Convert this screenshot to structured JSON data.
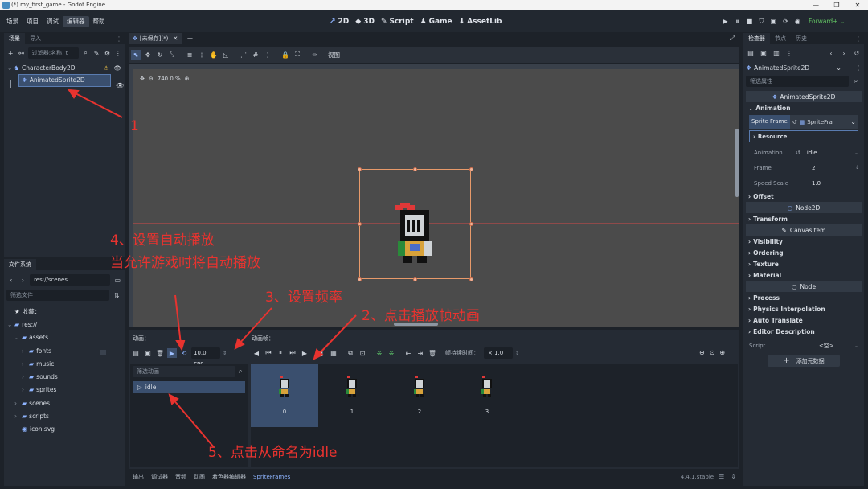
{
  "window": {
    "title": "(*) my_first_game - Godot Engine"
  },
  "menu": [
    "场景",
    "项目",
    "调试",
    "编辑器",
    "帮助"
  ],
  "workspaces": [
    {
      "icon": "↗",
      "label": "2D"
    },
    {
      "icon": "◆",
      "label": "3D"
    },
    {
      "icon": "✎",
      "label": "Script"
    },
    {
      "icon": "♟",
      "label": "Game"
    },
    {
      "icon": "⬇",
      "label": "AssetLib"
    }
  ],
  "renderer": "Forward+",
  "scene_dock": {
    "tabs": [
      "场景",
      "导入"
    ],
    "filter_placeholder": "过滤器:名称, t",
    "nodes": [
      "CharacterBody2D",
      "AnimatedSprite2D"
    ]
  },
  "filesystem_dock": {
    "tab": "文件系统",
    "path": "res://scenes",
    "filter_placeholder": "筛选文件",
    "favorites": "收藏：",
    "items": [
      {
        "label": "res://",
        "indent": 0,
        "type": "folder"
      },
      {
        "label": "assets",
        "indent": 1,
        "type": "folder"
      },
      {
        "label": "fonts",
        "indent": 2,
        "type": "folder"
      },
      {
        "label": "music",
        "indent": 2,
        "type": "folder"
      },
      {
        "label": "sounds",
        "indent": 2,
        "type": "folder"
      },
      {
        "label": "sprites",
        "indent": 2,
        "type": "folder"
      },
      {
        "label": "scenes",
        "indent": 1,
        "type": "folder"
      },
      {
        "label": "scripts",
        "indent": 1,
        "type": "folder"
      },
      {
        "label": "icon.svg",
        "indent": 1,
        "type": "file"
      }
    ]
  },
  "editor_tab": "[未保存](*)",
  "viewport": {
    "zoom": "740.0 %",
    "view_label": "视图"
  },
  "animation_panel": {
    "anim_label": "动画：",
    "frames_label": "动画帧：",
    "fps": "10.0 FPS",
    "frame_duration_label": "帧持续时间：",
    "frame_duration": "× 1.0",
    "filter_placeholder": "筛选动画",
    "animations": [
      "idle"
    ],
    "frames": [
      "0",
      "1",
      "2",
      "3"
    ]
  },
  "bottom_tabs": [
    "输出",
    "调试器",
    "音频",
    "动画",
    "着色器编辑器",
    "SpriteFrames"
  ],
  "version": "4.4.1.stable",
  "inspector": {
    "tabs": [
      "检查器",
      "节点",
      "历史"
    ],
    "node_name": "AnimatedSprite2D",
    "filter_placeholder": "筛选属性",
    "class_header": "AnimatedSprite2D",
    "section_animation": "Animation",
    "sprite_frames_label": "Sprite Frame",
    "sprite_frames_value": "SpriteFra",
    "resource_label": "Resource",
    "animation_label": "Animation",
    "animation_value": "idle",
    "frame_label": "Frame",
    "frame_value": "2",
    "speed_label": "Speed Scale",
    "speed_value": "1.0",
    "offset_label": "Offset",
    "node2d_header": "Node2D",
    "transform_label": "Transform",
    "canvasitem_header": "CanvasItem",
    "canvas_sections": [
      "Visibility",
      "Ordering",
      "Texture",
      "Material"
    ],
    "node_header": "Node",
    "node_sections": [
      "Process",
      "Physics Interpolation",
      "Auto Translate",
      "Editor Description"
    ],
    "script_label": "Script",
    "script_value": "<空>",
    "add_metadata": "添加元数据"
  },
  "annotations": {
    "a1": "1",
    "a2": "2、点击播放帧动画",
    "a3": "3、设置频率",
    "a4_line1": "4、设置自动播放",
    "a4_line2": "当允许游戏时将自动播放",
    "a5": "5、点击从命名为idle"
  },
  "colors": {
    "accent": "#8eb4ff",
    "annotation": "#e8332f",
    "selection": "#3a4f6e"
  }
}
